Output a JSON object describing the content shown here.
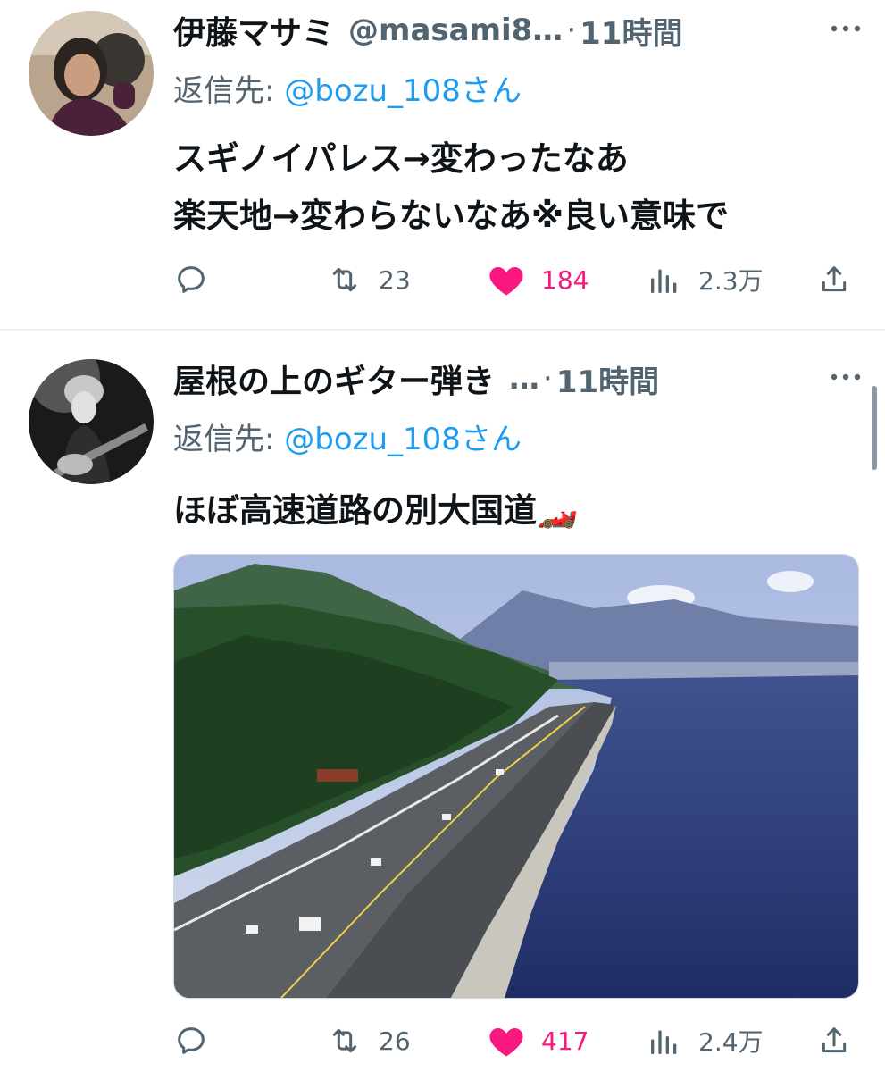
{
  "tweets": [
    {
      "name": "伊藤マサミ",
      "handle": "@masami8…",
      "separator": "·",
      "time": "11時間",
      "reply_prefix": "返信先: ",
      "reply_to": "@bozu_108さん",
      "text_lines": [
        "スギノイパレス→変わったなあ",
        "楽天地→変わらないなあ※良い意味で"
      ],
      "replies": "",
      "retweets": "23",
      "likes": "184",
      "views": "2.3万"
    },
    {
      "name": "屋根の上のギター弾き",
      "handle": "…",
      "separator": "·",
      "time": "11時間",
      "reply_prefix": "返信先: ",
      "reply_to": "@bozu_108さん",
      "text_lines": [
        "ほぼ高速道路の別大国道🏎️"
      ],
      "replies": "",
      "retweets": "26",
      "likes": "417",
      "views": "2.4万"
    }
  ],
  "colors": {
    "text": "#0f1419",
    "secondary": "#536471",
    "mention": "#1d9bf0",
    "like": "#f91880",
    "divider": "#eff3f4"
  }
}
